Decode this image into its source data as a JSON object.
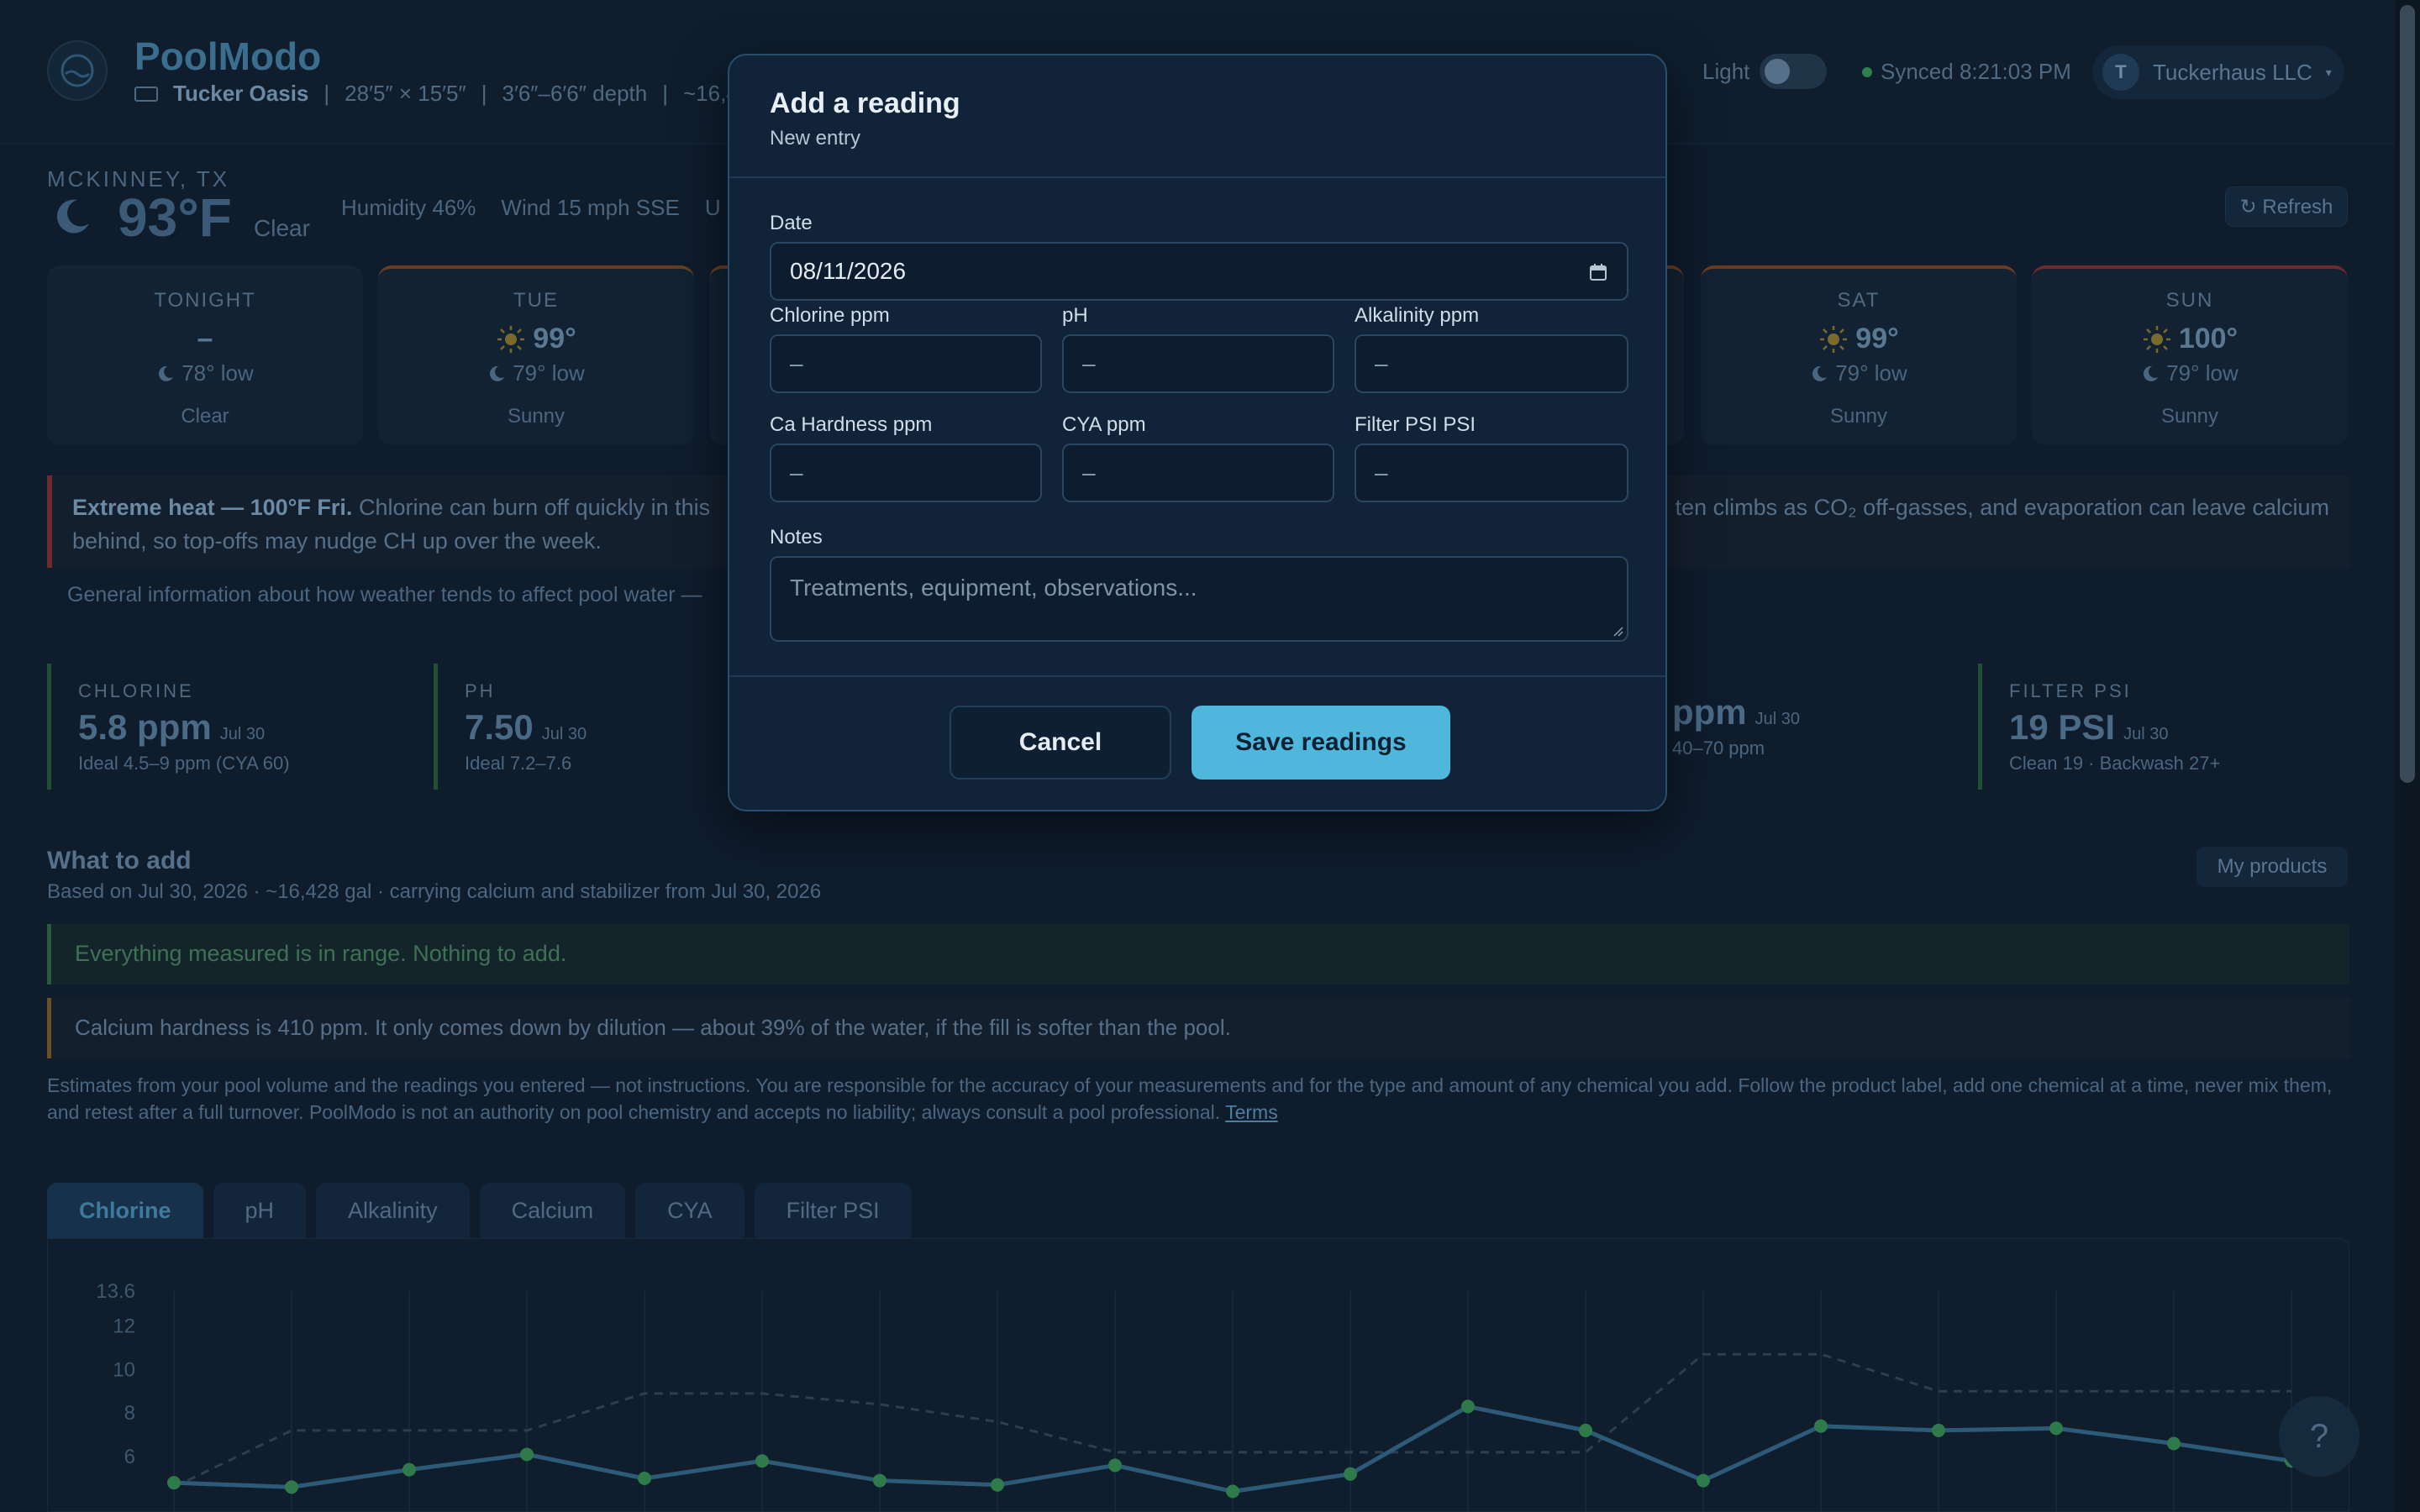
{
  "header": {
    "brand": "PoolModo",
    "pool_name": "Tucker Oasis",
    "dimensions": "28′5″ × 15′5″",
    "depth": "3′6″–6′6″ depth",
    "volume_partial": "~16,4",
    "light_label": "Light",
    "synced": "Synced 8:21:03 PM",
    "account_initial": "T",
    "account_name": "Tuckerhaus LLC"
  },
  "weather": {
    "location": "MCKINNEY, TX",
    "temp": "93°F",
    "condition": "Clear",
    "humidity": "Humidity 46%",
    "wind": "Wind 15 mph SSE",
    "extra_partial": "U",
    "refresh_label": "↻ Refresh",
    "days": [
      {
        "name": "TONIGHT",
        "hi": "–",
        "lo": "78° low",
        "cond": "Clear"
      },
      {
        "name": "TUE",
        "hi": "99°",
        "lo": "79° low",
        "cond": "Sunny"
      },
      {
        "name": "SAT",
        "hi": "99°",
        "lo": "79° low",
        "cond": "Sunny"
      },
      {
        "name": "SUN",
        "hi": "100°",
        "lo": "79° low",
        "cond": "Sunny"
      }
    ]
  },
  "alert": {
    "bold": "Extreme heat — 100°F Fri.",
    "text_left": "Chlorine can burn off quickly in this",
    "text_right": "ten climbs as CO₂ off-gasses, and evaporation can leave calcium",
    "text_line2": "behind, so top-offs may nudge CH up over the week.",
    "general_info": "General information about how weather tends to affect pool water —"
  },
  "metrics": [
    {
      "label": "CHLORINE",
      "value": "5.8 ppm",
      "date": "Jul 30",
      "range": "Ideal 4.5–9 ppm (CYA 60)"
    },
    {
      "label": "PH",
      "value": "7.50",
      "date": "Jul 30",
      "range": "Ideal 7.2–7.6"
    },
    {
      "label": "",
      "value": "ppm",
      "date": "Jul 30",
      "range": "40–70 ppm"
    },
    {
      "label": "FILTER PSI",
      "value": "19 PSI",
      "date": "Jul 30",
      "range": "Clean 19 · Backwash 27+"
    }
  ],
  "what_to_add": {
    "title": "What to add",
    "subtitle": "Based on Jul 30, 2026 · ~16,428 gal · carrying calcium and stabilizer from Jul 30, 2026",
    "my_products": "My products",
    "ok_message": "Everything measured is in range. Nothing to add.",
    "warn_message": "Calcium hardness is 410 ppm. It only comes down by dilution — about 39% of the water, if the fill is softer than the pool.",
    "disclaimer": "Estimates from your pool volume and the readings you entered — not instructions. You are responsible for the accuracy of your measurements and for the type and amount of any chemical you add. Follow the product label, add one chemical at a time, never mix them, and retest after a full turnover. PoolModo is not an authority on pool chemistry and accepts no liability; always consult a pool professional.",
    "terms": "Terms"
  },
  "tabs": [
    "Chlorine",
    "pH",
    "Alkalinity",
    "Calcium",
    "CYA",
    "Filter PSI"
  ],
  "chart_data": {
    "type": "line",
    "title": "",
    "xlabel": "",
    "ylabel": "",
    "y_ticks": [
      "13.6",
      "12",
      "10",
      "8",
      "6"
    ],
    "ylim": [
      4,
      13.6
    ],
    "series": [
      {
        "name": "",
        "values": [
          4.8,
          4.6,
          5.4,
          6.1,
          5.0,
          5.8,
          4.9,
          4.7,
          5.6,
          4.4,
          5.2,
          8.3,
          7.2,
          4.9,
          7.4,
          7.2,
          7.3,
          6.6,
          5.8
        ]
      }
    ],
    "ideal_band_upper": [
      4.6,
      7.2,
      7.2,
      7.2,
      8.9,
      8.9,
      8.4,
      7.6,
      6.2,
      6.2,
      6.2,
      6.2,
      6.2,
      10.7,
      10.7,
      9.0,
      9.0,
      9.0,
      9.0
    ],
    "grid": true
  },
  "help_label": "?",
  "modal": {
    "title": "Add a reading",
    "subtitle": "New entry",
    "date_label": "Date",
    "date_value": "08/11/2026",
    "fields": [
      {
        "label": "Chlorine ppm",
        "placeholder": "–"
      },
      {
        "label": "pH",
        "placeholder": "–"
      },
      {
        "label": "Alkalinity ppm",
        "placeholder": "–"
      },
      {
        "label": "Ca Hardness ppm",
        "placeholder": "–"
      },
      {
        "label": "CYA ppm",
        "placeholder": "–"
      },
      {
        "label": "Filter PSI PSI",
        "placeholder": "–"
      }
    ],
    "notes_label": "Notes",
    "notes_placeholder": "Treatments, equipment, observations...",
    "cancel_label": "Cancel",
    "save_label": "Save readings"
  },
  "colors": {
    "accent": "#4fb7dc",
    "modal_bg": "#112338",
    "page_bg": "#0f1c2c",
    "good": "#2f7f4f",
    "heat_alert": "#6e2b2b"
  }
}
